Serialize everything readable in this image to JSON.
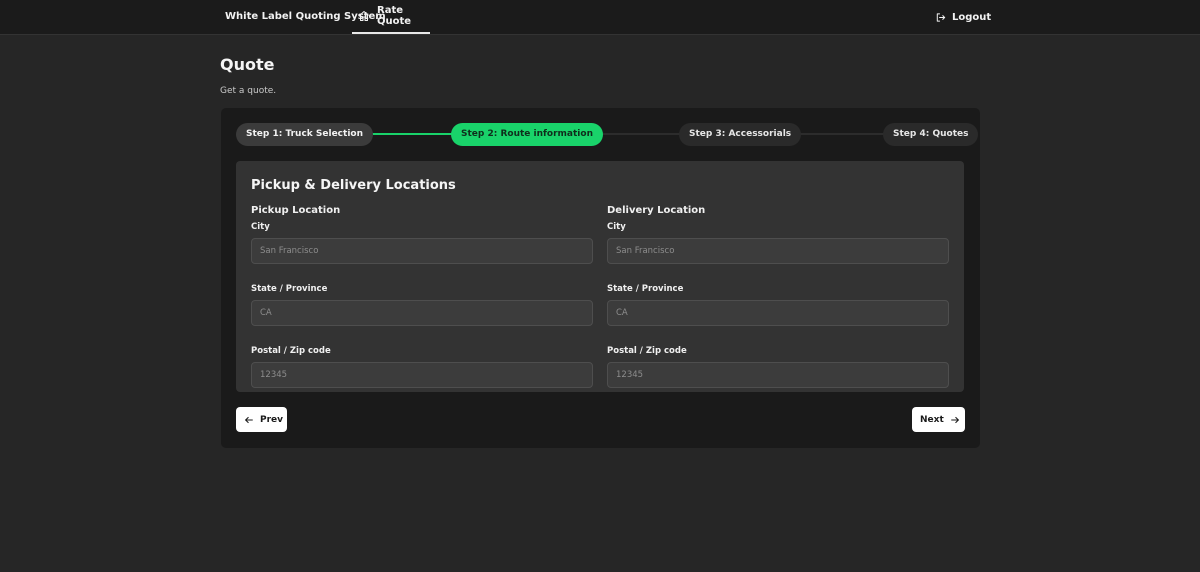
{
  "nav": {
    "brand": "White Label Quoting System",
    "tab_label": "Rate Quote",
    "tab_icon": "home-icon",
    "logout_label": "Logout",
    "logout_icon": "logout-icon"
  },
  "page": {
    "title": "Quote",
    "subtitle": "Get a quote."
  },
  "stepper": {
    "steps": [
      {
        "label": "Step 1: Truck Selection",
        "state": "done"
      },
      {
        "label": "Step 2: Route information",
        "state": "active"
      },
      {
        "label": "Step 3: Accessorials",
        "state": "todo"
      },
      {
        "label": "Step 4: Quotes",
        "state": "todo"
      }
    ]
  },
  "form": {
    "title": "Pickup & Delivery Locations",
    "pickup": {
      "title": "Pickup Location",
      "city_label": "City",
      "city_placeholder": "San Francisco",
      "state_label": "State / Province",
      "state_placeholder": "CA",
      "postal_label": "Postal / Zip code",
      "postal_placeholder": "12345"
    },
    "delivery": {
      "title": "Delivery Location",
      "city_label": "City",
      "city_placeholder": "San Francisco",
      "state_label": "State / Province",
      "state_placeholder": "CA",
      "postal_label": "Postal / Zip code",
      "postal_placeholder": "12345"
    }
  },
  "actions": {
    "prev_label": "Prev",
    "prev_icon": "arrow-left-icon",
    "next_label": "Next",
    "next_icon": "arrow-right-icon"
  },
  "colors": {
    "accent": "#19d36a",
    "background": "#262626",
    "panel": "#1a1a1a",
    "card": "#333333"
  }
}
